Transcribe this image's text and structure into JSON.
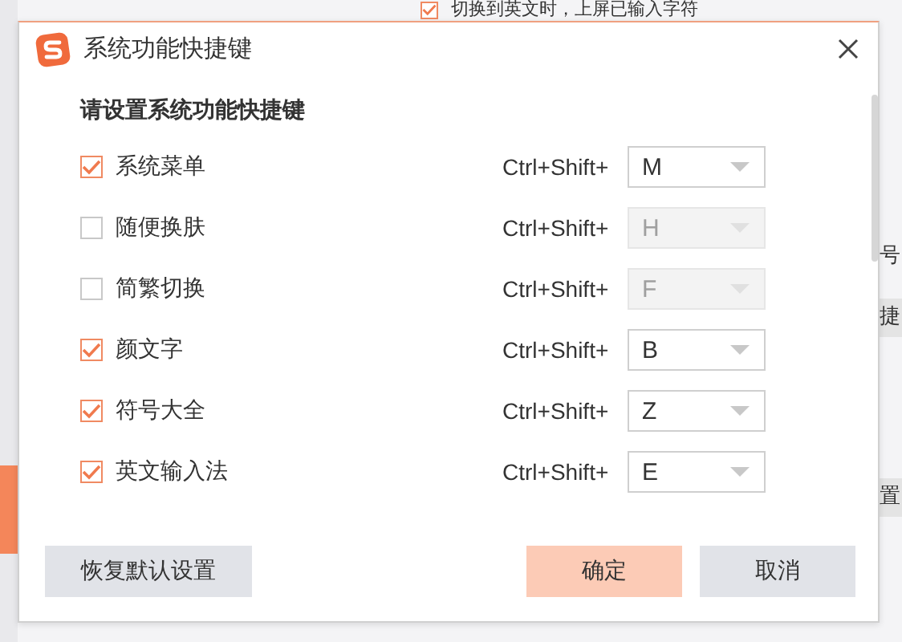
{
  "background": {
    "option": {
      "label": "切换到英文时，上屏已输入字符",
      "checked": true
    },
    "fragments": [
      {
        "text": "号",
        "banded": false
      },
      {
        "text": "捷",
        "banded": true
      },
      {
        "text": "置",
        "banded": true
      }
    ]
  },
  "dialog": {
    "title": "系统功能快捷键",
    "heading": "请设置系统功能快捷键",
    "rows": [
      {
        "label": "系统菜单",
        "checked": true,
        "modifier": "Ctrl+Shift+",
        "key": "M",
        "disabled": false
      },
      {
        "label": "随便换肤",
        "checked": false,
        "modifier": "Ctrl+Shift+",
        "key": "H",
        "disabled": true
      },
      {
        "label": "简繁切换",
        "checked": false,
        "modifier": "Ctrl+Shift+",
        "key": "F",
        "disabled": true
      },
      {
        "label": "颜文字",
        "checked": true,
        "modifier": "Ctrl+Shift+",
        "key": "B",
        "disabled": false
      },
      {
        "label": "符号大全",
        "checked": true,
        "modifier": "Ctrl+Shift+",
        "key": "Z",
        "disabled": false
      },
      {
        "label": "英文输入法",
        "checked": true,
        "modifier": "Ctrl+Shift+",
        "key": "E",
        "disabled": false
      }
    ],
    "buttons": [
      {
        "label": "恢复默认设置",
        "kind": "secondary"
      },
      {
        "label": "确定",
        "kind": "primary"
      },
      {
        "label": "取消",
        "kind": "secondary"
      }
    ]
  }
}
